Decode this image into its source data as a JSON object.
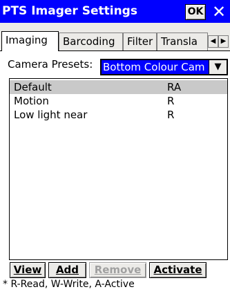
{
  "window": {
    "title": "PTS Imager Settings",
    "ok_label": "OK",
    "close_label": "✕"
  },
  "tabs": [
    {
      "label": "Imaging",
      "active": true
    },
    {
      "label": "Barcoding",
      "active": false
    },
    {
      "label": "Filter",
      "active": false
    },
    {
      "label": "Transla",
      "active": false
    }
  ],
  "tab_scroll": {
    "left": "◀",
    "right": "▶"
  },
  "presets": {
    "label": "Camera Presets:",
    "selected": "Bottom Colour Cam",
    "arrow": "▼"
  },
  "list": [
    {
      "name": "Default",
      "flags": "RA",
      "selected": true
    },
    {
      "name": "Motion",
      "flags": "R",
      "selected": false
    },
    {
      "name": "Low light near",
      "flags": "R",
      "selected": false
    }
  ],
  "buttons": {
    "view": "View",
    "add": "Add",
    "remove": "Remove",
    "activate": "Activate"
  },
  "footnote": "* R-Read, W-Write, A-Active"
}
